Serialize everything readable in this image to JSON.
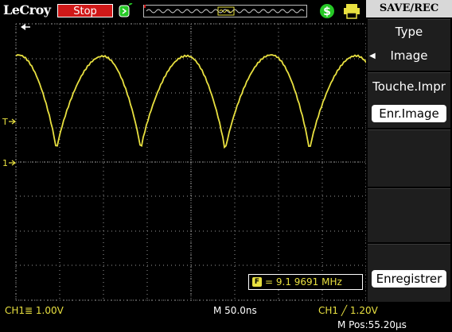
{
  "header": {
    "brand": "LeCroy",
    "run_status": "Stop"
  },
  "menu": {
    "title": "SAVE/REC",
    "type_label": "Type",
    "type_value": "Image",
    "print_label": "Touche.Impr",
    "print_value": "Enr.Image",
    "save_button": "Enregistrer"
  },
  "status": {
    "ch1_scale": "CH1≣ 1.00V",
    "time_base": "M 50.0ns",
    "trigger": "CH1 ╱ 1.20V",
    "m_pos": "M Pos:55.20μs"
  },
  "measurement": {
    "frequency": "= 9.1 9691 MHz"
  },
  "colors": {
    "trace": "#e8e040",
    "stop_bg": "#d01818",
    "grid": "#9a9a9a",
    "green_icon": "#26c826"
  },
  "icons": [
    "trigger-icon",
    "memory-bar-icon",
    "dollar-icon",
    "printer-icon",
    "frequency-icon"
  ]
}
